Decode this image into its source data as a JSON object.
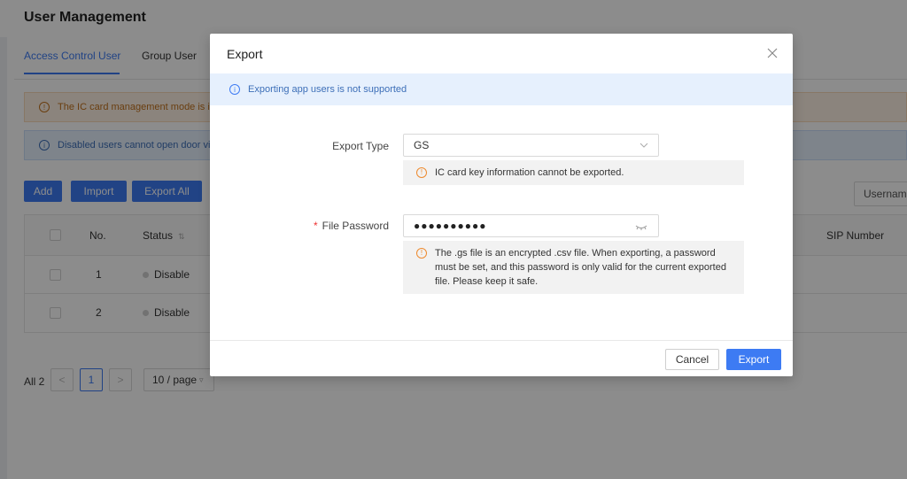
{
  "page": {
    "title": "User Management",
    "tabs": [
      "Access Control User",
      "Group User"
    ],
    "active_tab": "Access Control User",
    "alerts": {
      "warning": "The IC card management mode is inse",
      "info": "Disabled users cannot open door via e"
    },
    "toolbar": {
      "add": "Add",
      "import": "Import",
      "export_all": "Export All",
      "search_select": "Usernam"
    },
    "table": {
      "headers": {
        "no": "No.",
        "status": "Status",
        "sip": "SIP Number"
      },
      "rows": [
        {
          "no": "1",
          "status": "Disable"
        },
        {
          "no": "2",
          "status": "Disable"
        }
      ]
    },
    "pager": {
      "total": "All 2",
      "prev": "<",
      "current": "1",
      "next": ">",
      "page_size": "10 / page"
    }
  },
  "modal": {
    "title": "Export",
    "notice": "Exporting app users is not supported",
    "export_type": {
      "label": "Export Type",
      "value": "GS",
      "tip": "IC card key information cannot be exported."
    },
    "file_password": {
      "required_mark": "*",
      "label": "File Password",
      "value": "●●●●●●●●●●",
      "tip": "The .gs file is an encrypted .csv file. When exporting, a password must be set, and this password is only valid for the current exported file. Please keep it safe."
    },
    "buttons": {
      "cancel": "Cancel",
      "export": "Export"
    }
  },
  "colors": {
    "primary": "#3d7bf3",
    "warning": "#ee8a2e",
    "required": "#e33333",
    "info_bg": "#e6f0fd"
  }
}
